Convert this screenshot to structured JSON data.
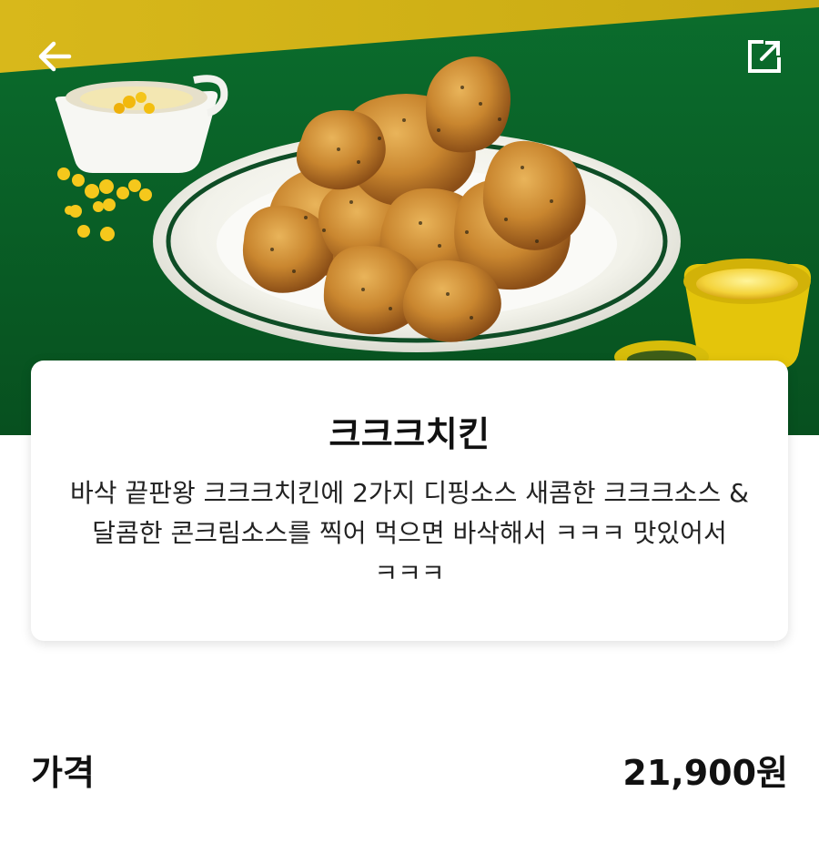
{
  "header": {
    "back_icon": "back-arrow-icon",
    "share_icon": "share-icon"
  },
  "hero": {
    "image": "food-photo-fried-chicken"
  },
  "colors": {
    "hero_green": "#0a6128",
    "hero_yellow": "#d8b81b",
    "text_dark": "#111111"
  },
  "product": {
    "name": "크크크치킨",
    "description": "바삭 끝판왕 크크크치킨에 2가지 디핑소스 새콤한 크크크소스 & 달콤한 콘크림소스를 찍어 먹으면 바삭해서 ㅋㅋㅋ 맛있어서 ㅋㅋㅋ"
  },
  "price": {
    "label": "가격",
    "value": "21,900원"
  }
}
